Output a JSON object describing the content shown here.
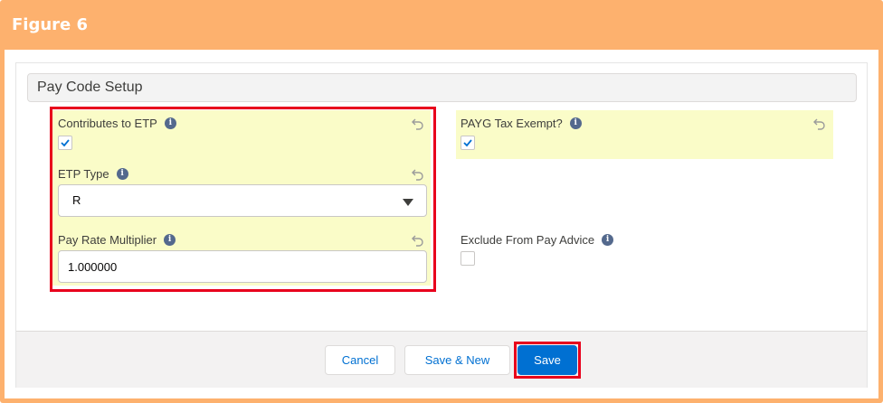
{
  "figure": {
    "title": "Figure 6"
  },
  "section": {
    "title": "Pay Code Setup"
  },
  "fields": {
    "contributes_to_etp": {
      "label": "Contributes to ETP",
      "checked": true
    },
    "etp_type": {
      "label": "ETP Type",
      "value": "R"
    },
    "pay_rate_multiplier": {
      "label": "Pay Rate Multiplier",
      "value": "1.000000"
    },
    "payg_tax_exempt": {
      "label": "PAYG Tax Exempt?",
      "checked": true
    },
    "exclude_from_pay_advice": {
      "label": "Exclude From Pay Advice",
      "checked": false
    }
  },
  "info_glyph": "i",
  "footer": {
    "cancel_label": "Cancel",
    "save_new_label": "Save & New",
    "save_label": "Save"
  },
  "colors": {
    "figure_frame": "#fdb16e",
    "changed_field_highlight": "#fafcc8",
    "highlight_box": "#e8001c",
    "brand_button": "#0070d2"
  },
  "icons": {
    "info": "info-icon",
    "undo": "undo-icon",
    "check": "checkmark-icon",
    "dropdown": "caret-down-icon"
  }
}
